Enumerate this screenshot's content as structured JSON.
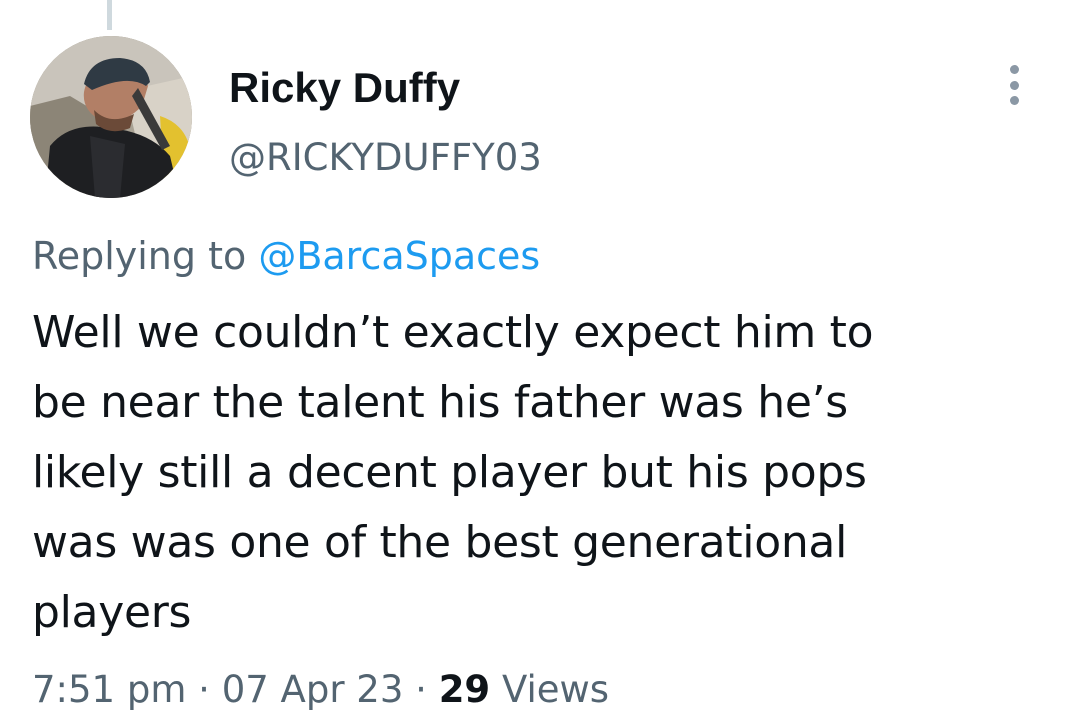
{
  "author": {
    "display_name": "Ricky Duffy",
    "handle": "@RICKYDUFFY03"
  },
  "reply": {
    "prefix": "Replying to ",
    "mention": "@BarcaSpaces"
  },
  "tweet": {
    "text": "Well we couldn’t exactly expect him to\nbe near the talent his father was he’s\nlikely still a decent player but his pops\nwas was one of the best generational\nplayers"
  },
  "meta": {
    "time": "7:51 pm",
    "separator": " · ",
    "date": "07 Apr 23",
    "views_count": "29",
    "views_label": " Views"
  },
  "icons": {
    "more": "more-vertical-icon",
    "avatar": "user-avatar"
  },
  "colors": {
    "link": "#1d9bf0",
    "secondary_text": "#536471",
    "primary_text": "#0f1419"
  }
}
